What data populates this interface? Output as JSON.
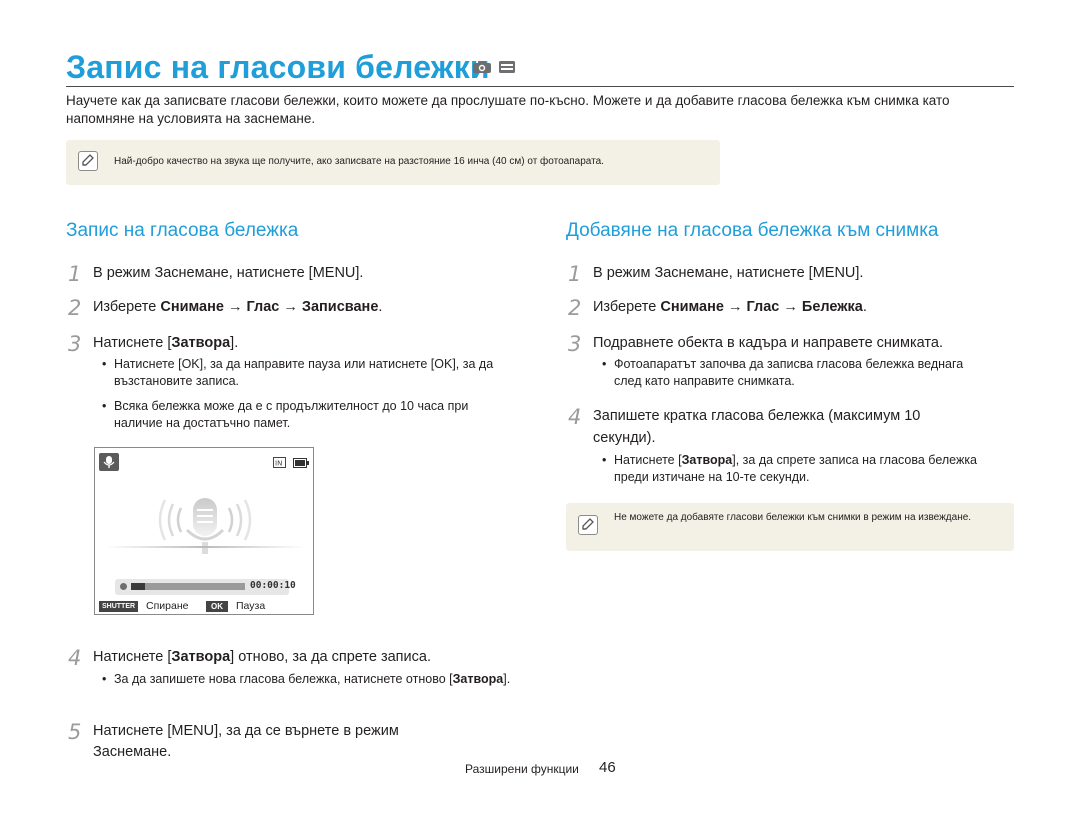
{
  "title": "Запис на гласови бележки",
  "intro": "Научете как да записвате гласови бележки, които можете да прослушате по-късно. Можете и да добавите гласова бележка към снимка като напомняне на условията на заснемане.",
  "note_top": "Най-добро качество на звука ще получите, ако записвате на разстояние 16 инча (40 см) от фотоапарата.",
  "left": {
    "heading": "Запис на гласова бележка",
    "step1": {
      "num": "1",
      "text": "В режим Заснемане, натиснете [MENU]."
    },
    "step2": {
      "num": "2",
      "pre": "Изберете ",
      "b1": "Снимане",
      "arrow1": " → ",
      "b2": "Глас",
      "arrow2": " → ",
      "b3": "Записване",
      "post": "."
    },
    "step3": {
      "num": "3",
      "pre": "Натиснете [",
      "b": "Затвора",
      "post": "]."
    },
    "bullet1": "Натиснете [OK], за да направите пауза или натиснете [OK], за да възстановите записа.",
    "bullet2": "Всяка бележка може да е с продължителност до 10 часа при наличие на достатъчно памет.",
    "screen": {
      "time": "00:00:10",
      "shutter_key": "SHUTTER",
      "shutter_label": "Спиране",
      "ok_key": "OK",
      "ok_label": "Пауза",
      "recording_progress": 0.12
    },
    "step4": {
      "num": "4",
      "pre": "Натиснете [",
      "b": "Затвора",
      "post": "] отново, за да спрете записа."
    },
    "bullet3_pre": "За да запишете нова гласова бележка, натиснете отново [",
    "bullet3_b": "Затвора",
    "bullet3_post": "].",
    "step5": {
      "num": "5",
      "line1": "Натиснете [MENU], за да се върнете в режим",
      "line2": "Заснемане."
    }
  },
  "right": {
    "heading": "Добавяне на гласова бележка към снимка",
    "step1": {
      "num": "1",
      "text": "В режим Заснемане, натиснете [MENU]."
    },
    "step2": {
      "num": "2",
      "pre": "Изберете ",
      "b1": "Снимане",
      "arrow1": " → ",
      "b2": "Глас",
      "arrow2": " → ",
      "b3": "Бележка",
      "post": "."
    },
    "step3": {
      "num": "3",
      "text": "Подравнете обекта в кадъра и направете снимката."
    },
    "bullet1": "Фотоапаратът започва да записва гласова бележка веднага след като направите снимката.",
    "step4": {
      "num": "4",
      "line1": "Запишете кратка гласова бележка (максимум 10",
      "line2": "секунди)."
    },
    "bullet2_pre": "Натиснете [",
    "bullet2_b": "Затвора",
    "bullet2_post": "], за да спрете записа на гласова бележка преди изтичане на 10-те секунди.",
    "note": "Не можете да добавяте гласови бележки към снимки в режим на извеждане."
  },
  "footer": {
    "label": "Разширени функции",
    "page": "46"
  },
  "colors": {
    "accent": "#1f9ed9",
    "note_bg": "#f3f1e6",
    "step_num": "#9b9b9b"
  },
  "icons": [
    "camera-mode-icon",
    "scene-mode-icon",
    "note-pencil-icon",
    "microphone-icon",
    "memory-icon",
    "battery-icon"
  ]
}
